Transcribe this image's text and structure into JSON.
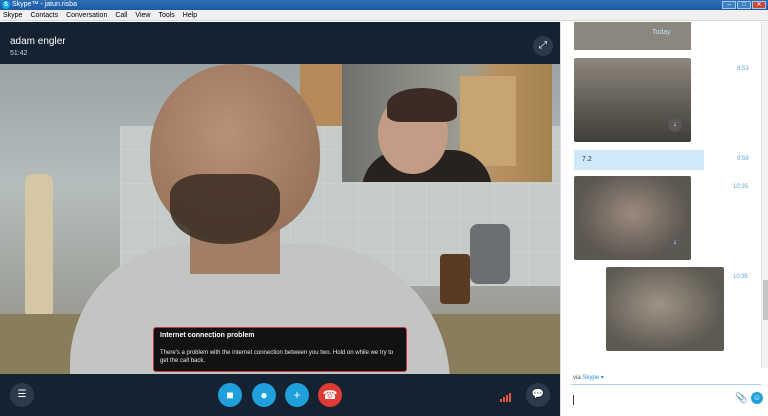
{
  "window": {
    "title": "Skype™ - jatun.risba"
  },
  "menu": [
    "Skype",
    "Contacts",
    "Conversation",
    "Call",
    "View",
    "Tools",
    "Help"
  ],
  "call": {
    "caller_name": "adam engler",
    "duration": "51:42",
    "notice_title": "Internet connection problem",
    "notice_text": "There's a problem with the internet connection between you two. Hold on while we try to get the call back."
  },
  "chat": {
    "today_label": "Today",
    "timestamps": [
      "9:53",
      "9:59",
      "10:35",
      "10:35"
    ],
    "message": "7.2",
    "via_prefix": "via",
    "via_service": "Skype"
  },
  "icons": [
    "skype-logo-icon",
    "expand-icon",
    "list-icon",
    "video-icon",
    "microphone-icon",
    "add-icon",
    "end-call-icon",
    "signal-icon",
    "chat-icon",
    "download-icon",
    "attach-icon",
    "emoji-icon"
  ],
  "colors": {
    "accent": "#1fa0dc",
    "end_call": "#e03a35",
    "notice_border": "#c83a3a",
    "timestamp": "#5aa9d9"
  }
}
